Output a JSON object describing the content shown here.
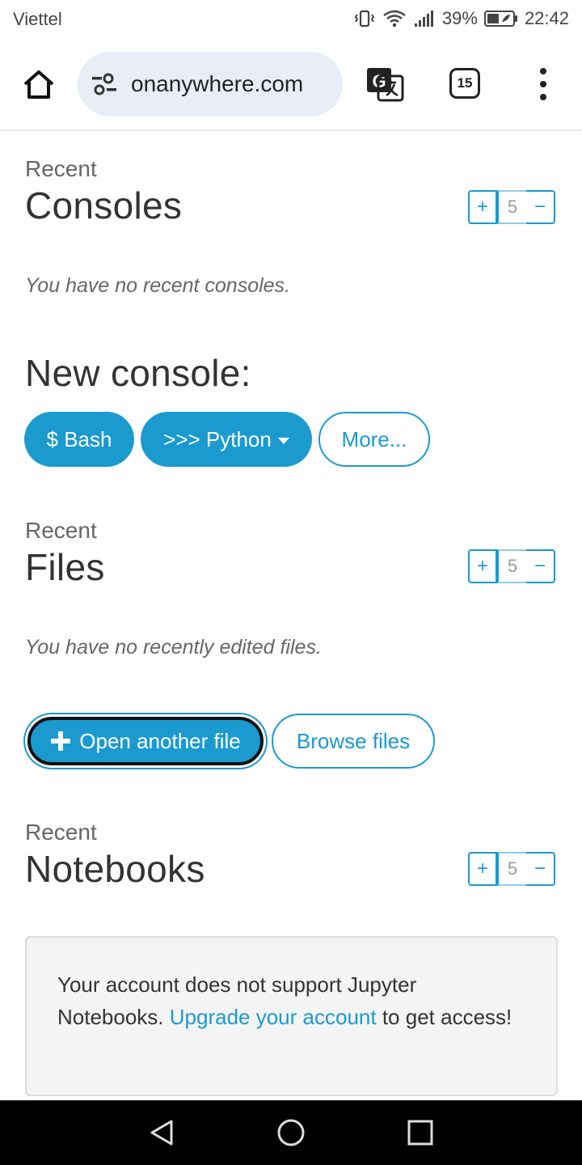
{
  "status_bar": {
    "carrier": "Viettel",
    "battery": "39%",
    "time": "22:42"
  },
  "browser": {
    "url": "onanywhere.com",
    "tab_count": "15"
  },
  "consoles": {
    "kicker": "Recent",
    "title": "Consoles",
    "stepper": {
      "plus": "+",
      "value": "5",
      "minus": "−"
    },
    "empty": "You have no recent consoles."
  },
  "new_console": {
    "title": "New console:",
    "bash_label": "$ Bash",
    "python_label": ">>> Python",
    "more_label": "More..."
  },
  "files": {
    "kicker": "Recent",
    "title": "Files",
    "stepper": {
      "plus": "+",
      "value": "5",
      "minus": "−"
    },
    "empty": "You have no recently edited files.",
    "open_label": "Open another file",
    "browse_label": "Browse files"
  },
  "notebooks": {
    "kicker": "Recent",
    "title": "Notebooks",
    "stepper": {
      "plus": "+",
      "value": "5",
      "minus": "−"
    },
    "notice_prefix": "Your account does not support Jupyter Notebooks.",
    "notice_link": "Upgrade your account",
    "notice_suffix": "to get access!"
  },
  "colors": {
    "accent": "#1b9ad0",
    "pill_bg": "#e8edf6",
    "notice_bg": "#f4f4f4"
  },
  "icons": {
    "home": "home-icon",
    "tune": "tune-icon",
    "translate": "translate-icon",
    "menu": "more-vert-icon",
    "back": "back-icon",
    "home_nav": "home-circle-icon",
    "recents": "recents-icon"
  }
}
